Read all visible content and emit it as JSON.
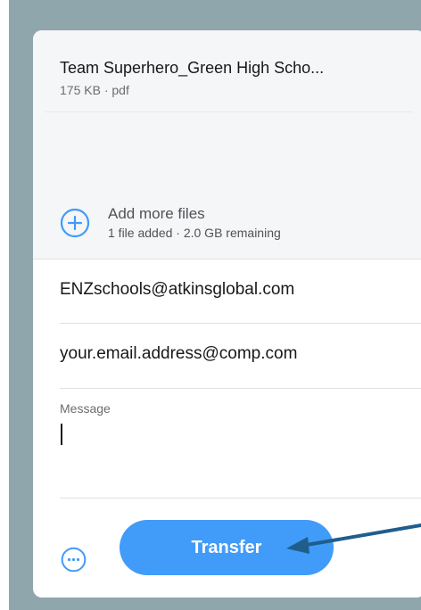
{
  "file": {
    "name": "Team Superhero_Green High Scho...",
    "meta": "175 KB · pdf"
  },
  "add_files": {
    "label": "Add more files",
    "status": "1 file added · 2.0 GB remaining"
  },
  "recipient": {
    "value": "ENZschools@atkinsglobal.com"
  },
  "sender": {
    "value": "your.email.address@comp.com"
  },
  "message": {
    "label": "Message"
  },
  "actions": {
    "transfer_label": "Transfer"
  },
  "colors": {
    "accent": "#419bf9",
    "backdrop": "#8fa6ac",
    "arrow": "#1f5e8c"
  }
}
